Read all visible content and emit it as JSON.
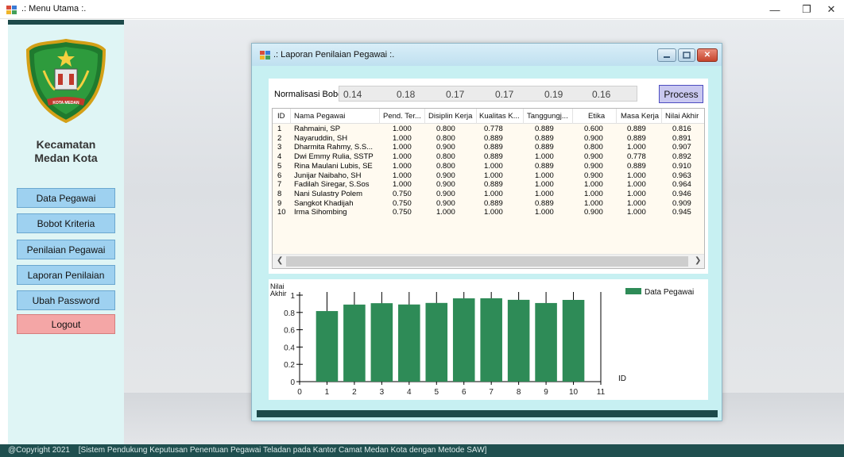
{
  "window": {
    "title": ".: Menu Utama :."
  },
  "sidebar": {
    "brand_line1": "Kecamatan",
    "brand_line2": "Medan Kota",
    "logo_text": "KOTA MEDAN",
    "items": [
      {
        "label": "Data Pegawai"
      },
      {
        "label": "Bobot Kriteria"
      },
      {
        "label": "Penilaian Pegawai"
      },
      {
        "label": "Laporan Penilaian"
      },
      {
        "label": "Ubah Password"
      },
      {
        "label": "Logout"
      }
    ]
  },
  "child": {
    "title": ".: Laporan Penilaian Pegawai :.",
    "bobot_label": "Normalisasi Bobot :",
    "bobot_values": [
      "0.14",
      "0.18",
      "0.17",
      "0.17",
      "0.19",
      "0.16"
    ],
    "process_label": "Process",
    "columns": [
      "ID",
      "Nama Pegawai",
      "Pend. Ter...",
      "Disiplin Kerja",
      "Kualitas K...",
      "Tanggungj...",
      "Etika",
      "Masa Kerja",
      "Nilai Akhir"
    ],
    "rows": [
      [
        "1",
        "Rahmaini, SP",
        "1.000",
        "0.800",
        "0.778",
        "0.889",
        "0.600",
        "0.889",
        "0.816"
      ],
      [
        "2",
        "Nayaruddin, SH",
        "1.000",
        "0.800",
        "0.889",
        "0.889",
        "0.900",
        "0.889",
        "0.891"
      ],
      [
        "3",
        "Dharmita Rahmy, S.S...",
        "1.000",
        "0.900",
        "0.889",
        "0.889",
        "0.800",
        "1.000",
        "0.907"
      ],
      [
        "4",
        "Dwi Emmy Rulia, SSTP",
        "1.000",
        "0.800",
        "0.889",
        "1.000",
        "0.900",
        "0.778",
        "0.892"
      ],
      [
        "5",
        "Rina Maulani Lubis, SE",
        "1.000",
        "0.800",
        "1.000",
        "0.889",
        "0.900",
        "0.889",
        "0.910"
      ],
      [
        "6",
        "Junijar Naibaho, SH",
        "1.000",
        "0.900",
        "1.000",
        "1.000",
        "0.900",
        "1.000",
        "0.963"
      ],
      [
        "7",
        "Fadilah Siregar, S.Sos",
        "1.000",
        "0.900",
        "0.889",
        "1.000",
        "1.000",
        "1.000",
        "0.964"
      ],
      [
        "8",
        "Nani Sulastry Polem",
        "0.750",
        "0.900",
        "1.000",
        "1.000",
        "1.000",
        "1.000",
        "0.946"
      ],
      [
        "9",
        "Sangkot Khadijah",
        "0.750",
        "0.900",
        "0.889",
        "0.889",
        "1.000",
        "1.000",
        "0.909"
      ],
      [
        "10",
        "Irma Sihombing",
        "0.750",
        "1.000",
        "1.000",
        "1.000",
        "0.900",
        "1.000",
        "0.945"
      ]
    ]
  },
  "chart_data": {
    "type": "bar",
    "ylabel": "Nilai Akhir",
    "xlabel": "ID",
    "x": [
      1,
      2,
      3,
      4,
      5,
      6,
      7,
      8,
      9,
      10
    ],
    "values": [
      0.816,
      0.891,
      0.907,
      0.892,
      0.91,
      0.963,
      0.964,
      0.946,
      0.909,
      0.945
    ],
    "xlim": [
      0,
      11
    ],
    "ylim": [
      0,
      1
    ],
    "xticks": [
      "0",
      "1",
      "2",
      "3",
      "4",
      "5",
      "6",
      "7",
      "8",
      "9",
      "10",
      "11"
    ],
    "yticks": [
      "0",
      "0.2",
      "0.4",
      "0.6",
      "0.8",
      "1"
    ],
    "legend": [
      "Data Pegawai"
    ],
    "legend_position": "top-right",
    "bar_color": "#2e8b57"
  },
  "footer": {
    "copyright": "@Copyright 2021",
    "description": "[Sistem Pendukung Keputusan Penentuan Pegawai Teladan pada Kantor Camat Medan Kota dengan Metode SAW]"
  }
}
